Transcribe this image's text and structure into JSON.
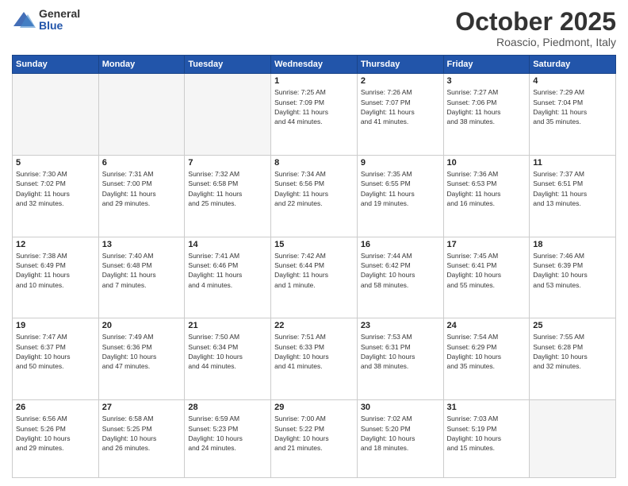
{
  "logo": {
    "general": "General",
    "blue": "Blue"
  },
  "header": {
    "month": "October 2025",
    "location": "Roascio, Piedmont, Italy"
  },
  "weekdays": [
    "Sunday",
    "Monday",
    "Tuesday",
    "Wednesday",
    "Thursday",
    "Friday",
    "Saturday"
  ],
  "weeks": [
    [
      {
        "day": "",
        "info": ""
      },
      {
        "day": "",
        "info": ""
      },
      {
        "day": "",
        "info": ""
      },
      {
        "day": "1",
        "info": "Sunrise: 7:25 AM\nSunset: 7:09 PM\nDaylight: 11 hours\nand 44 minutes."
      },
      {
        "day": "2",
        "info": "Sunrise: 7:26 AM\nSunset: 7:07 PM\nDaylight: 11 hours\nand 41 minutes."
      },
      {
        "day": "3",
        "info": "Sunrise: 7:27 AM\nSunset: 7:06 PM\nDaylight: 11 hours\nand 38 minutes."
      },
      {
        "day": "4",
        "info": "Sunrise: 7:29 AM\nSunset: 7:04 PM\nDaylight: 11 hours\nand 35 minutes."
      }
    ],
    [
      {
        "day": "5",
        "info": "Sunrise: 7:30 AM\nSunset: 7:02 PM\nDaylight: 11 hours\nand 32 minutes."
      },
      {
        "day": "6",
        "info": "Sunrise: 7:31 AM\nSunset: 7:00 PM\nDaylight: 11 hours\nand 29 minutes."
      },
      {
        "day": "7",
        "info": "Sunrise: 7:32 AM\nSunset: 6:58 PM\nDaylight: 11 hours\nand 25 minutes."
      },
      {
        "day": "8",
        "info": "Sunrise: 7:34 AM\nSunset: 6:56 PM\nDaylight: 11 hours\nand 22 minutes."
      },
      {
        "day": "9",
        "info": "Sunrise: 7:35 AM\nSunset: 6:55 PM\nDaylight: 11 hours\nand 19 minutes."
      },
      {
        "day": "10",
        "info": "Sunrise: 7:36 AM\nSunset: 6:53 PM\nDaylight: 11 hours\nand 16 minutes."
      },
      {
        "day": "11",
        "info": "Sunrise: 7:37 AM\nSunset: 6:51 PM\nDaylight: 11 hours\nand 13 minutes."
      }
    ],
    [
      {
        "day": "12",
        "info": "Sunrise: 7:38 AM\nSunset: 6:49 PM\nDaylight: 11 hours\nand 10 minutes."
      },
      {
        "day": "13",
        "info": "Sunrise: 7:40 AM\nSunset: 6:48 PM\nDaylight: 11 hours\nand 7 minutes."
      },
      {
        "day": "14",
        "info": "Sunrise: 7:41 AM\nSunset: 6:46 PM\nDaylight: 11 hours\nand 4 minutes."
      },
      {
        "day": "15",
        "info": "Sunrise: 7:42 AM\nSunset: 6:44 PM\nDaylight: 11 hours\nand 1 minute."
      },
      {
        "day": "16",
        "info": "Sunrise: 7:44 AM\nSunset: 6:42 PM\nDaylight: 10 hours\nand 58 minutes."
      },
      {
        "day": "17",
        "info": "Sunrise: 7:45 AM\nSunset: 6:41 PM\nDaylight: 10 hours\nand 55 minutes."
      },
      {
        "day": "18",
        "info": "Sunrise: 7:46 AM\nSunset: 6:39 PM\nDaylight: 10 hours\nand 53 minutes."
      }
    ],
    [
      {
        "day": "19",
        "info": "Sunrise: 7:47 AM\nSunset: 6:37 PM\nDaylight: 10 hours\nand 50 minutes."
      },
      {
        "day": "20",
        "info": "Sunrise: 7:49 AM\nSunset: 6:36 PM\nDaylight: 10 hours\nand 47 minutes."
      },
      {
        "day": "21",
        "info": "Sunrise: 7:50 AM\nSunset: 6:34 PM\nDaylight: 10 hours\nand 44 minutes."
      },
      {
        "day": "22",
        "info": "Sunrise: 7:51 AM\nSunset: 6:33 PM\nDaylight: 10 hours\nand 41 minutes."
      },
      {
        "day": "23",
        "info": "Sunrise: 7:53 AM\nSunset: 6:31 PM\nDaylight: 10 hours\nand 38 minutes."
      },
      {
        "day": "24",
        "info": "Sunrise: 7:54 AM\nSunset: 6:29 PM\nDaylight: 10 hours\nand 35 minutes."
      },
      {
        "day": "25",
        "info": "Sunrise: 7:55 AM\nSunset: 6:28 PM\nDaylight: 10 hours\nand 32 minutes."
      }
    ],
    [
      {
        "day": "26",
        "info": "Sunrise: 6:56 AM\nSunset: 5:26 PM\nDaylight: 10 hours\nand 29 minutes."
      },
      {
        "day": "27",
        "info": "Sunrise: 6:58 AM\nSunset: 5:25 PM\nDaylight: 10 hours\nand 26 minutes."
      },
      {
        "day": "28",
        "info": "Sunrise: 6:59 AM\nSunset: 5:23 PM\nDaylight: 10 hours\nand 24 minutes."
      },
      {
        "day": "29",
        "info": "Sunrise: 7:00 AM\nSunset: 5:22 PM\nDaylight: 10 hours\nand 21 minutes."
      },
      {
        "day": "30",
        "info": "Sunrise: 7:02 AM\nSunset: 5:20 PM\nDaylight: 10 hours\nand 18 minutes."
      },
      {
        "day": "31",
        "info": "Sunrise: 7:03 AM\nSunset: 5:19 PM\nDaylight: 10 hours\nand 15 minutes."
      },
      {
        "day": "",
        "info": ""
      }
    ]
  ]
}
